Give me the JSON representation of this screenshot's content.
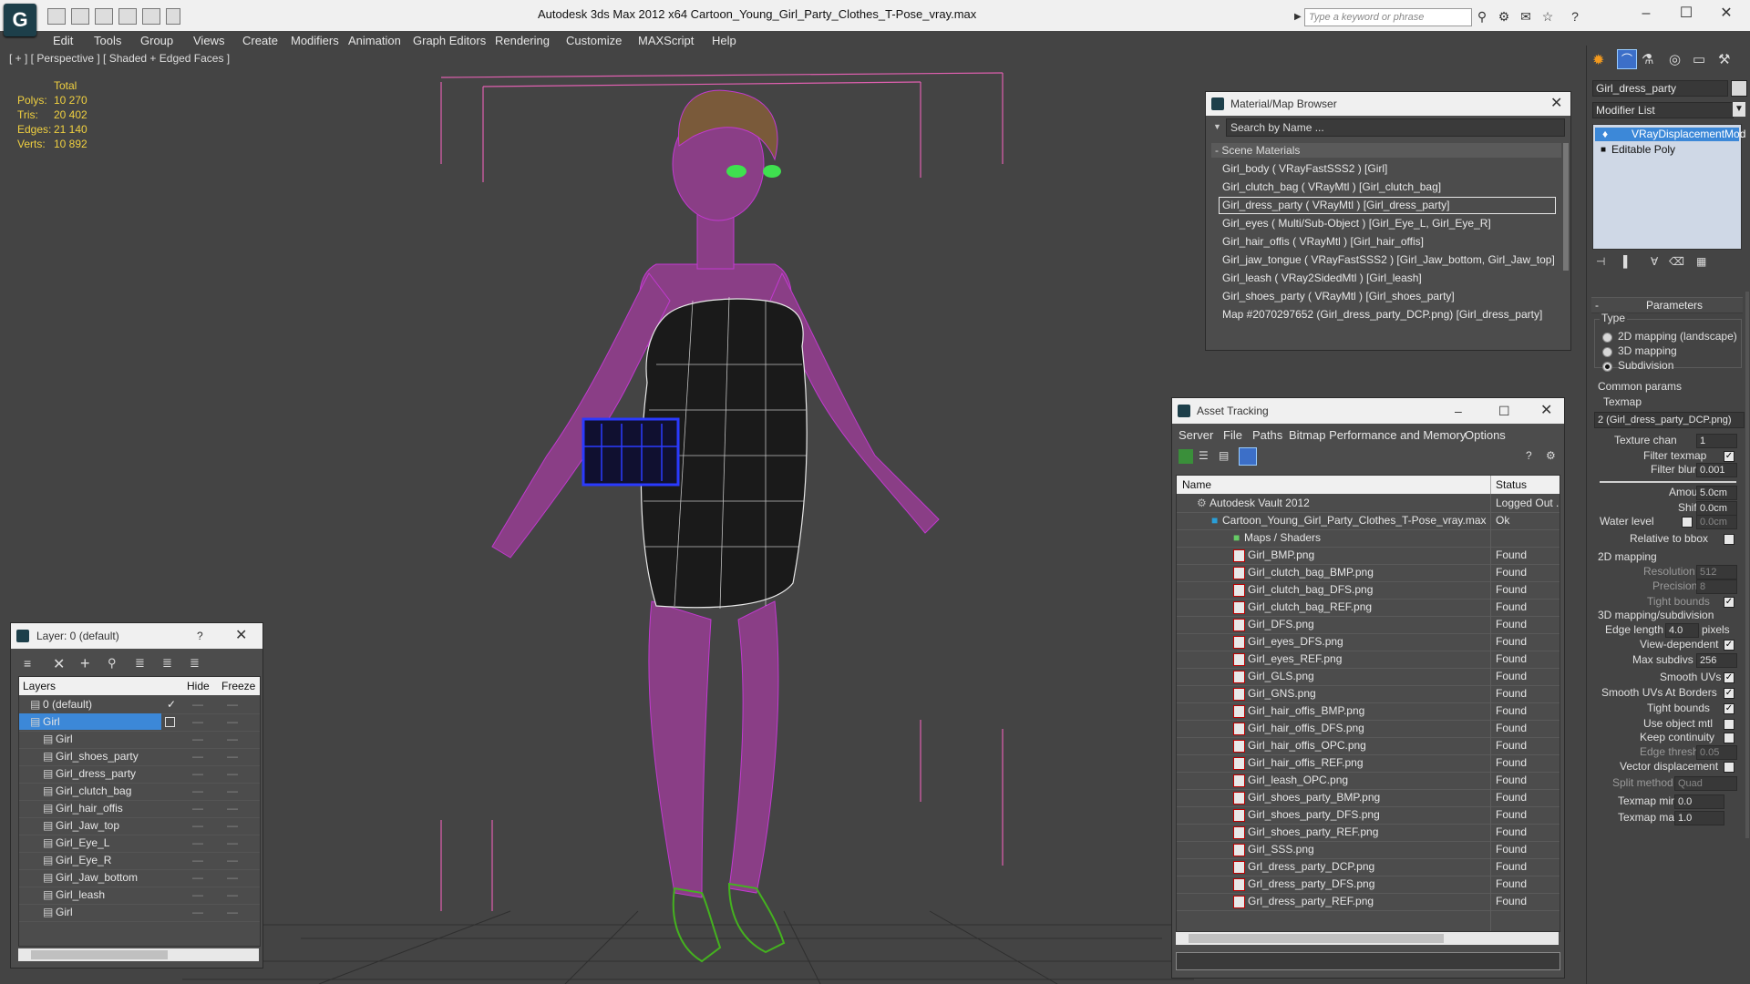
{
  "app": {
    "title": "Autodesk 3ds Max  2012 x64      Cartoon_Young_Girl_Party_Clothes_T-Pose_vray.max",
    "logo": "3ds-max-logo",
    "search_placeholder": "Type a keyword or phrase"
  },
  "menu": [
    "Edit",
    "Tools",
    "Group",
    "Views",
    "Create",
    "Modifiers",
    "Animation",
    "Graph Editors",
    "Rendering",
    "Customize",
    "MAXScript",
    "Help"
  ],
  "viewport": {
    "label": "[ + ] [ Perspective ] [ Shaded + Edged Faces ]",
    "stats": {
      "header": "Total",
      "rows": [
        {
          "label": "Polys:",
          "value": "10 270"
        },
        {
          "label": "Tris:",
          "value": "20 402"
        },
        {
          "label": "Edges:",
          "value": "21 140"
        },
        {
          "label": "Verts:",
          "value": "10 892"
        }
      ]
    }
  },
  "material_browser": {
    "title": "Material/Map Browser",
    "search_placeholder": "Search by Name ...",
    "group": "- Scene Materials",
    "items": [
      "Girl_body  ( VRayFastSSS2 ) [Girl]",
      "Girl_clutch_bag  ( VRayMtl ) [Girl_clutch_bag]",
      "Girl_dress_party  ( VRayMtl ) [Girl_dress_party]",
      "Girl_eyes  ( Multi/Sub-Object ) [Girl_Eye_L, Girl_Eye_R]",
      "Girl_hair_offis  ( VRayMtl ) [Girl_hair_offis]",
      "Girl_jaw_tongue  ( VRayFastSSS2 ) [Girl_Jaw_bottom, Girl_Jaw_top]",
      "Girl_leash  ( VRay2SidedMtl ) [Girl_leash]",
      "Girl_shoes_party  ( VRayMtl ) [Girl_shoes_party]",
      "Map #2070297652 (Girl_dress_party_DCP.png) [Girl_dress_party]"
    ],
    "selected_index": 2
  },
  "asset_tracking": {
    "title": "Asset Tracking",
    "menu": [
      "Server",
      "File",
      "Paths",
      "Bitmap Performance and Memory",
      "Options"
    ],
    "columns": [
      "Name",
      "Status"
    ],
    "root": {
      "name": "Autodesk Vault 2012",
      "status": "Logged Out ..."
    },
    "file": {
      "name": "Cartoon_Young_Girl_Party_Clothes_T-Pose_vray.max",
      "status": "Ok"
    },
    "group": "Maps / Shaders",
    "maps": [
      {
        "name": "Girl_BMP.png",
        "status": "Found"
      },
      {
        "name": "Girl_clutch_bag_BMP.png",
        "status": "Found"
      },
      {
        "name": "Girl_clutch_bag_DFS.png",
        "status": "Found"
      },
      {
        "name": "Girl_clutch_bag_REF.png",
        "status": "Found"
      },
      {
        "name": "Girl_DFS.png",
        "status": "Found"
      },
      {
        "name": "Girl_eyes_DFS.png",
        "status": "Found"
      },
      {
        "name": "Girl_eyes_REF.png",
        "status": "Found"
      },
      {
        "name": "Girl_GLS.png",
        "status": "Found"
      },
      {
        "name": "Girl_GNS.png",
        "status": "Found"
      },
      {
        "name": "Girl_hair_offis_BMP.png",
        "status": "Found"
      },
      {
        "name": "Girl_hair_offis_DFS.png",
        "status": "Found"
      },
      {
        "name": "Girl_hair_offis_OPC.png",
        "status": "Found"
      },
      {
        "name": "Girl_hair_offis_REF.png",
        "status": "Found"
      },
      {
        "name": "Girl_leash_OPC.png",
        "status": "Found"
      },
      {
        "name": "Girl_shoes_party_BMP.png",
        "status": "Found"
      },
      {
        "name": "Girl_shoes_party_DFS.png",
        "status": "Found"
      },
      {
        "name": "Girl_shoes_party_REF.png",
        "status": "Found"
      },
      {
        "name": "Girl_SSS.png",
        "status": "Found"
      },
      {
        "name": "Grl_dress_party_DCP.png",
        "status": "Found"
      },
      {
        "name": "Grl_dress_party_DFS.png",
        "status": "Found"
      },
      {
        "name": "Grl_dress_party_REF.png",
        "status": "Found"
      }
    ]
  },
  "layer_panel": {
    "title": "Layer: 0 (default)",
    "help": "?",
    "columns": [
      "Layers",
      "Hide",
      "Freeze"
    ],
    "rows": [
      {
        "name": "0 (default)",
        "level": 0,
        "selected": false,
        "active": true
      },
      {
        "name": "Girl",
        "level": 0,
        "selected": true,
        "active": false
      },
      {
        "name": "Girl",
        "level": 1,
        "selected": false,
        "active": false
      },
      {
        "name": "Girl_shoes_party",
        "level": 1,
        "selected": false,
        "active": false
      },
      {
        "name": "Girl_dress_party",
        "level": 1,
        "selected": false,
        "active": false
      },
      {
        "name": "Girl_clutch_bag",
        "level": 1,
        "selected": false,
        "active": false
      },
      {
        "name": "Girl_hair_offis",
        "level": 1,
        "selected": false,
        "active": false
      },
      {
        "name": "Girl_Jaw_top",
        "level": 1,
        "selected": false,
        "active": false
      },
      {
        "name": "Girl_Eye_L",
        "level": 1,
        "selected": false,
        "active": false
      },
      {
        "name": "Girl_Eye_R",
        "level": 1,
        "selected": false,
        "active": false
      },
      {
        "name": "Girl_Jaw_bottom",
        "level": 1,
        "selected": false,
        "active": false
      },
      {
        "name": "Girl_leash",
        "level": 1,
        "selected": false,
        "active": false
      },
      {
        "name": "Girl",
        "level": 1,
        "selected": false,
        "active": false
      }
    ]
  },
  "command_panel": {
    "object_name": "Girl_dress_party",
    "modifier_list_label": "Modifier List",
    "stack": [
      "VRayDisplacementMod",
      "Editable Poly"
    ],
    "rollout": "Parameters",
    "type_group": "Type",
    "type_options": [
      {
        "label": "2D mapping (landscape)",
        "selected": false
      },
      {
        "label": "3D mapping",
        "selected": false
      },
      {
        "label": "Subdivision",
        "selected": true
      }
    ],
    "common_params": "Common params",
    "texmap_label": "Texmap",
    "texmap_value": "2 (Girl_dress_party_DCP.png)",
    "texture_chan": {
      "label": "Texture chan",
      "value": "1"
    },
    "filter_texmap": {
      "label": "Filter texmap",
      "checked": true
    },
    "filter_blur": {
      "label": "Filter blur",
      "value": "0.001"
    },
    "amount": {
      "label": "Amount",
      "value": "5.0cm"
    },
    "shift": {
      "label": "Shift",
      "value": "0.0cm"
    },
    "water_level": {
      "label": "Water level",
      "value": "0.0cm",
      "checked": false
    },
    "relative_to_bbox": {
      "label": "Relative to bbox",
      "checked": false
    },
    "mapping2d_group": "2D mapping",
    "resolution": {
      "label": "Resolution",
      "value": "512"
    },
    "precision": {
      "label": "Precision",
      "value": "8"
    },
    "tight_bounds_2d": {
      "label": "Tight bounds",
      "checked": true
    },
    "mapping3d_group": "3D mapping/subdivision",
    "edge_length": {
      "label": "Edge length",
      "value": "4.0",
      "unit": "pixels"
    },
    "view_dependent": {
      "label": "View-dependent",
      "checked": true
    },
    "max_subdivs": {
      "label": "Max subdivs",
      "value": "256"
    },
    "checks": [
      {
        "label": "Smooth UVs",
        "checked": true
      },
      {
        "label": "Smooth UVs At Borders",
        "checked": true
      },
      {
        "label": "Tight bounds",
        "checked": true
      },
      {
        "label": "Use object mtl",
        "checked": false
      },
      {
        "label": "Keep continuity",
        "checked": false
      }
    ],
    "edge_thresh": {
      "label": "Edge thresh",
      "value": "0.05"
    },
    "vector_displacement": {
      "label": "Vector displacement",
      "checked": false
    },
    "split_method": {
      "label": "Split method",
      "value": "Quad"
    },
    "texmap_min": {
      "label": "Texmap min:",
      "value": "0.0"
    },
    "texmap_max": {
      "label": "Texmap max:",
      "value": "1.0"
    }
  },
  "colors": {
    "viewport_bg": "#444444",
    "skin": "#8a3e86",
    "wire": "#c23ad0",
    "dress": "#1a1a1a",
    "bag": "#1a2a9a",
    "shoes": "#44b21f",
    "stats_text": "#f0d040",
    "selection": "#3c88d8"
  }
}
